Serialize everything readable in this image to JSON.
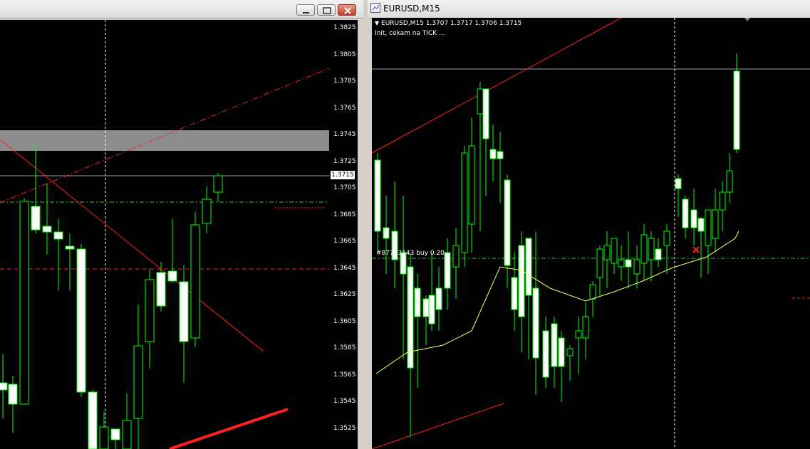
{
  "left_window": {
    "buttons": {
      "minimize": "minimize",
      "maximize": "maximize",
      "close": "close"
    },
    "price_axis": [
      "1.3825",
      "1.3805",
      "1.3785",
      "1.3765",
      "1.3745",
      "1.3725",
      "1.3705",
      "1.3685",
      "1.3665",
      "1.3645",
      "1.3625",
      "1.3605",
      "1.3585",
      "1.3565",
      "1.3545",
      "1.3525"
    ],
    "current_price": "1.3715"
  },
  "right_window": {
    "title": "EURUSD,M15",
    "header_line": "EURUSD,M15  1.3707 1.3717 1.3706 1.3715",
    "status_line": "Init, cekam na TICK ...",
    "order_label": "#87763143 buy 0.20"
  },
  "colors": {
    "bull": "#000000",
    "bear": "#ffffff",
    "wick": "#00ff00",
    "trendline": "#ff0000",
    "moving_average": "#ffff66",
    "background": "#000000"
  }
}
